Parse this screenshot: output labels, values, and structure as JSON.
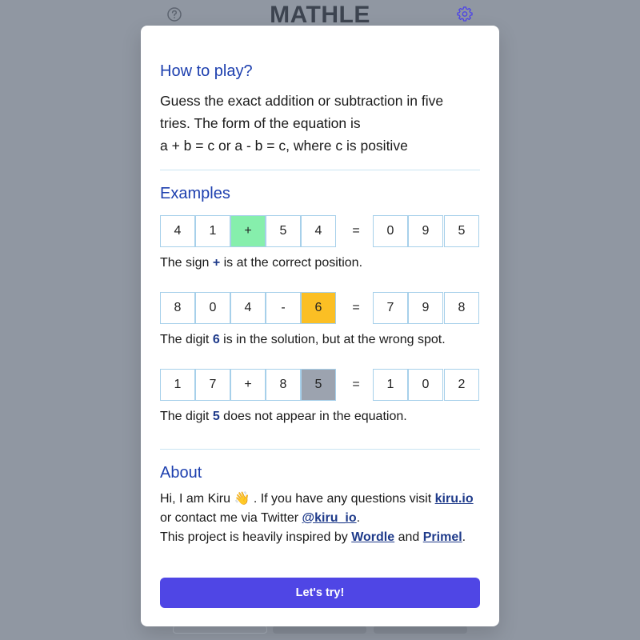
{
  "app": {
    "title": "MATHLE",
    "help_icon": "question-circle-icon",
    "settings_icon": "gear-icon"
  },
  "modal": {
    "how_to_play": {
      "title": "How to play?",
      "lines": [
        "Guess the exact addition or subtraction in five",
        "tries. The form of the equation is",
        "a + b = c or a - b = c, where c is positive"
      ]
    },
    "examples": {
      "title": "Examples",
      "items": [
        {
          "cells": [
            {
              "v": "4",
              "state": "none"
            },
            {
              "v": "1",
              "state": "none"
            },
            {
              "v": "+",
              "state": "green"
            },
            {
              "v": "5",
              "state": "none"
            },
            {
              "v": "4",
              "state": "none"
            },
            {
              "v": "=",
              "state": "eq"
            },
            {
              "v": "0",
              "state": "none"
            },
            {
              "v": "9",
              "state": "none"
            },
            {
              "v": "5",
              "state": "none"
            }
          ],
          "desc_before": "The sign ",
          "desc_bold": "+",
          "desc_after": " is at the correct position."
        },
        {
          "cells": [
            {
              "v": "8",
              "state": "none"
            },
            {
              "v": "0",
              "state": "none"
            },
            {
              "v": "4",
              "state": "none"
            },
            {
              "v": "-",
              "state": "none"
            },
            {
              "v": "6",
              "state": "yellow"
            },
            {
              "v": "=",
              "state": "eq"
            },
            {
              "v": "7",
              "state": "none"
            },
            {
              "v": "9",
              "state": "none"
            },
            {
              "v": "8",
              "state": "none"
            }
          ],
          "desc_before": "The digit ",
          "desc_bold": "6",
          "desc_after": " is in the solution, but at the wrong spot."
        },
        {
          "cells": [
            {
              "v": "1",
              "state": "none"
            },
            {
              "v": "7",
              "state": "none"
            },
            {
              "v": "+",
              "state": "none"
            },
            {
              "v": "8",
              "state": "none"
            },
            {
              "v": "5",
              "state": "gray"
            },
            {
              "v": "=",
              "state": "eq"
            },
            {
              "v": "1",
              "state": "none"
            },
            {
              "v": "0",
              "state": "none"
            },
            {
              "v": "2",
              "state": "none"
            }
          ],
          "desc_before": "The digit ",
          "desc_bold": "5",
          "desc_after": " does not appear in the equation."
        }
      ]
    },
    "about": {
      "title": "About",
      "line1_before": "Hi, I am Kiru 👋 . If you have any questions visit ",
      "line1_link": "kiru.io",
      "line2_before": "or contact me via Twitter ",
      "line2_link": "@kiru_io",
      "line2_after": ".",
      "line3_before": "This project is heavily inspired by ",
      "line3_link1": "Wordle",
      "line3_mid": " and ",
      "line3_link2": "Primel",
      "line3_after": "."
    },
    "cta_label": "Let's try!"
  },
  "colors": {
    "backdrop": "#9097a2",
    "heading": "#1e40af",
    "correct": "#86efac",
    "present": "#fbbf24",
    "absent": "#9ca3af",
    "button": "#4f46e5"
  }
}
